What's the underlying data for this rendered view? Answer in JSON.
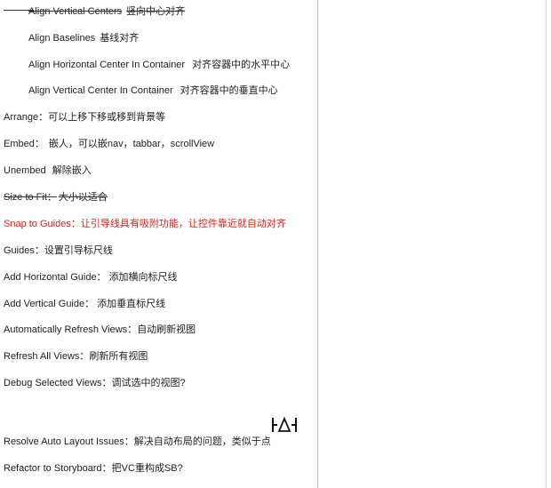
{
  "lines": [
    {
      "en": "Align Vertical Centers",
      "zh": "竖向中心对齐"
    },
    {
      "en": "Align Baselines",
      "zh": "基线对齐"
    },
    {
      "en": "Align Horizontal Center In Container",
      "zh": "对齐容器中的水平中心"
    },
    {
      "en": "Align Vertical Center In Container",
      "zh": "对齐容器中的垂直中心"
    },
    {
      "en": "Arrange",
      "zh": "可以上移下移或移到背景等"
    },
    {
      "en": "Embed：",
      "zh": "嵌人，可以嵌nav，tabbar，scrollView"
    },
    {
      "en": "Unembed",
      "zh": "解除嵌入"
    },
    {
      "en": "Size to Fit：",
      "zh": "大小以适合"
    },
    {
      "en": "Snap to Guides：",
      "zh": "让引导线具有吸附功能，让控件靠近就自动对齐"
    },
    {
      "en": "Guides：",
      "zh": "设置引导标尺线"
    },
    {
      "en": "Add Horizontal Guide：",
      "zh": "添加横向标尺线"
    },
    {
      "en": "Add Vertical Guide：",
      "zh": "添加垂直标尺线"
    },
    {
      "en": "Automatically Refresh Views：",
      "zh": "自动刷新视图"
    },
    {
      "en": "Refresh All Views：",
      "zh": "刷新所有视图"
    },
    {
      "en": "Debug Selected Views：",
      "zh": "调试选中的视图?"
    },
    {
      "en": "Resolve Auto Layout Issues：",
      "zh": "解决自动布局的问题，类似于点"
    },
    {
      "en": "Refactor to Storyboard：",
      "zh": "把VC重构成SB?"
    }
  ],
  "arrange_sep": "：",
  "colors": {
    "text": "#222222",
    "highlight": "#e0201a",
    "divider": "#bdbdbd"
  },
  "icon": "resolve-auto-layout-issues-icon"
}
